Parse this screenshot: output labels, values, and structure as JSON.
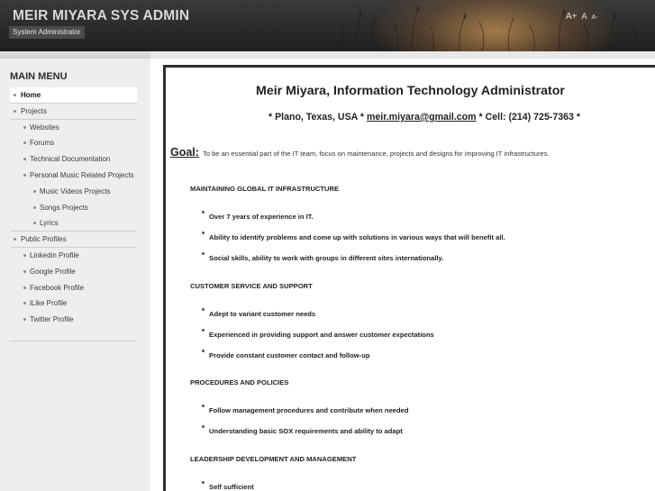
{
  "header": {
    "site_name": "MEIR MIYARA SYS ADMIN",
    "slogan": "System Administrator",
    "font_controls": {
      "increase": "A+",
      "normal": "A",
      "decrease": "A-"
    }
  },
  "sidebar": {
    "title": "MAIN MENU",
    "items": [
      {
        "label": "Home"
      },
      {
        "label": "Projects"
      },
      {
        "label": "Websites"
      },
      {
        "label": "Forums"
      },
      {
        "label": "Technical Documentation"
      },
      {
        "label": "Personal Music Related Projects"
      },
      {
        "label": "Music Videos Projects"
      },
      {
        "label": "Songs Projects"
      },
      {
        "label": "Lyrics"
      },
      {
        "label": "Public Profiles"
      },
      {
        "label": "Linkedin Profile"
      },
      {
        "label": "Google Profile"
      },
      {
        "label": "Facebook Profile"
      },
      {
        "label": "iLike Profile"
      },
      {
        "label": "Twitter Profile"
      }
    ]
  },
  "content": {
    "headline": "Meir Miyara, Information Technology Administrator",
    "contact_prefix": "* Plano, Texas, USA *",
    "email": "meir.miyara@gmail.com",
    "contact_suffix": "* Cell: (214) 725-7363 *",
    "goal_label": "Goal:",
    "goal_text": "To be an essential part of the IT team, focus on maintenance, projects and designs for improving IT infrastructures.",
    "sections": [
      {
        "title": "MAINTAINING GLOBAL IT INFRASTRUCTURE",
        "bullets": [
          "Over 7 years of experience in IT.",
          "Ability to identify problems and come up with solutions in various ways that will benefit all.",
          "Social skills, ability to work with groups in different sites internationally."
        ]
      },
      {
        "title": "CUSTOMER SERVICE AND SUPPORT",
        "bullets": [
          "Adept to variant customer needs",
          "Experienced in providing support and answer customer expectations",
          "Provide constant customer contact and follow-up"
        ]
      },
      {
        "title": "PROCEDURES AND POLICIES",
        "bullets": [
          "Follow management procedures and contribute when needed",
          "Understanding basic SOX requirements and ability to adapt"
        ]
      },
      {
        "title": "LEADERSHIP DEVELOPMENT AND MANAGEMENT",
        "bullets": [
          "Self sufficient"
        ]
      }
    ]
  }
}
